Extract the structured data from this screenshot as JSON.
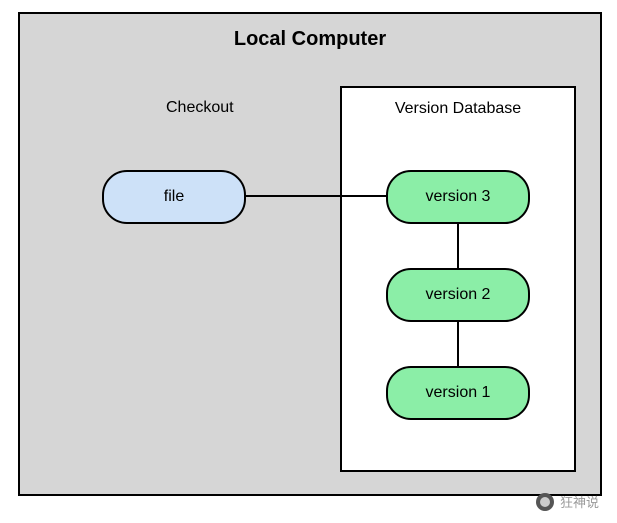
{
  "diagram": {
    "title": "Local Computer",
    "checkout": {
      "label": "Checkout",
      "file_label": "file"
    },
    "database": {
      "label": "Version Database",
      "versions": {
        "v3": "version 3",
        "v2": "version 2",
        "v1": "version 1"
      }
    }
  },
  "watermark": {
    "text": "狂神说"
  }
}
